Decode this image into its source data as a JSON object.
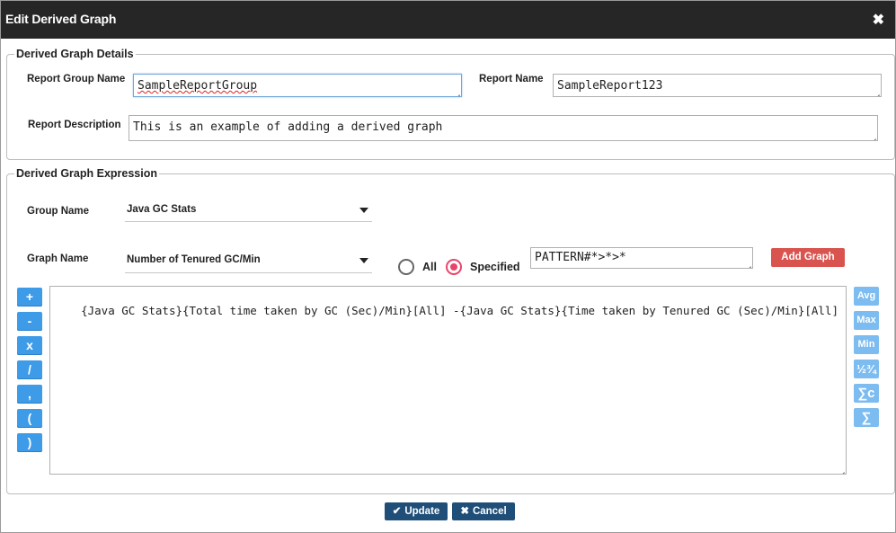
{
  "dialog": {
    "title": "Edit Derived Graph",
    "close_glyph": "✖"
  },
  "details": {
    "legend": "Derived Graph Details",
    "report_group_label": "Report Group Name",
    "report_group_value": "SampleReportGroup",
    "report_name_label": "Report Name",
    "report_name_value": "SampleReport123",
    "report_desc_label": "Report Description",
    "report_desc_value": "This is an example of adding a derived graph"
  },
  "expression": {
    "legend": "Derived Graph Expression",
    "group_label": "Group Name",
    "group_value": "Java GC Stats",
    "graph_label": "Graph Name",
    "graph_value": "Number of Tenured GC/Min",
    "radio_all_label": "All",
    "radio_specified_label": "Specified",
    "selected_radio": "Specified",
    "pattern_value": "PATTERN#*>*>*",
    "add_graph_label": "Add Graph",
    "operators": [
      "+",
      "-",
      "x",
      "/",
      ",",
      "(",
      ")"
    ],
    "functions": [
      "Avg",
      "Max",
      "Min",
      "½¾",
      "∑c",
      "∑"
    ],
    "expression_text": "{Java GC Stats}{Total time taken by GC (Sec)/Min}[All] -{Java GC Stats}{Time taken by Tenured GC (Sec)/Min}[All]"
  },
  "footer": {
    "update_label": "Update",
    "cancel_label": "Cancel"
  },
  "colors": {
    "titlebar": "#262626",
    "operator_button": "#3d9be8",
    "function_button": "#7cbcf0",
    "add_graph_button": "#d9534f",
    "footer_button": "#1f4e79",
    "radio_selected": "#e8446a"
  }
}
